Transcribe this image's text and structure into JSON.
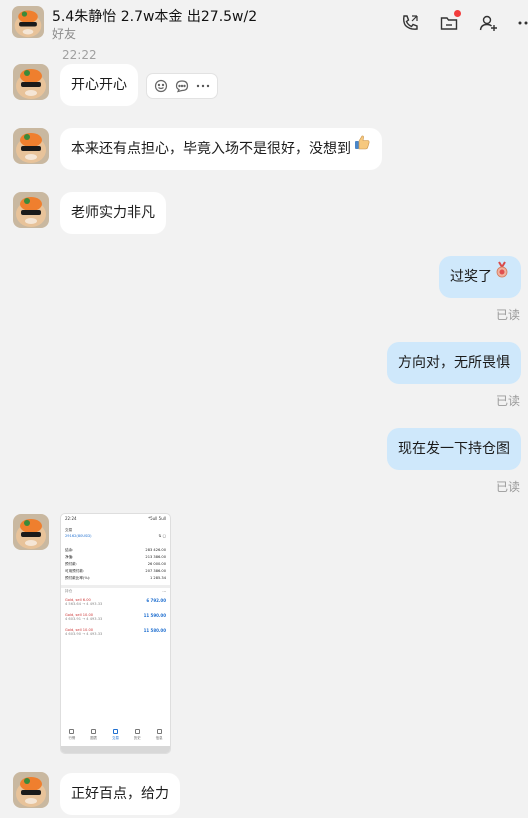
{
  "header": {
    "title": "5.4朱静怡 2.7w本金 出27.5w/2",
    "subtitle": "好友",
    "icons": [
      "phone-call-icon",
      "folder-icon",
      "add-friend-icon",
      "more-icon"
    ]
  },
  "timestamp": "22:22",
  "messages": [
    {
      "side": "in",
      "text": "开心开心"
    },
    {
      "side": "in",
      "text": "本来还有点担心，毕竟入场不是很好，没想到",
      "emoji": "thumbs-up-icon"
    },
    {
      "side": "in",
      "text": "老师实力非凡"
    },
    {
      "side": "out",
      "text": "过奖了",
      "emoji": "medal-icon",
      "status": "已读"
    },
    {
      "side": "out",
      "text": "方向对，无所畏惧",
      "status": "已读"
    },
    {
      "side": "out",
      "text": "现在发一下持仓图",
      "status": "已读"
    },
    {
      "side": "in",
      "type": "image"
    },
    {
      "side": "in",
      "text": "正好百点，给力"
    }
  ],
  "action_icons": [
    "emoji-reaction-icon",
    "reply-icon",
    "more-icon"
  ],
  "screenshot": {
    "status_time": "22:24",
    "status_right": "*5ull 5ull",
    "account_label": "交易",
    "account_number": "29162(80USD)",
    "summary": [
      {
        "label": "结余:",
        "value": "283 426.00"
      },
      {
        "label": "净值:",
        "value": "213 386.00"
      },
      {
        "label": "预付款:",
        "value": "26 000.00"
      },
      {
        "label": "可用预付款:",
        "value": "207 386.00"
      },
      {
        "label": "预付款比率(%):",
        "value": "1 285.34"
      }
    ],
    "positions_label": "持仓",
    "positions": [
      {
        "title": "Gold, sell 6.00",
        "detail": "4 563.64 → 4 493.33",
        "profit": "6 792.00"
      },
      {
        "title": "Gold, sell 10.00",
        "detail": "4 603.91 → 4 493.33",
        "profit": "11 590.00"
      },
      {
        "title": "Gold, sell 10.00",
        "detail": "4 603.90 → 4 493.33",
        "profit": "11 580.00"
      }
    ],
    "nav": [
      "行情",
      "图表",
      "交易",
      "历史",
      "信息"
    ]
  },
  "watermark": ""
}
